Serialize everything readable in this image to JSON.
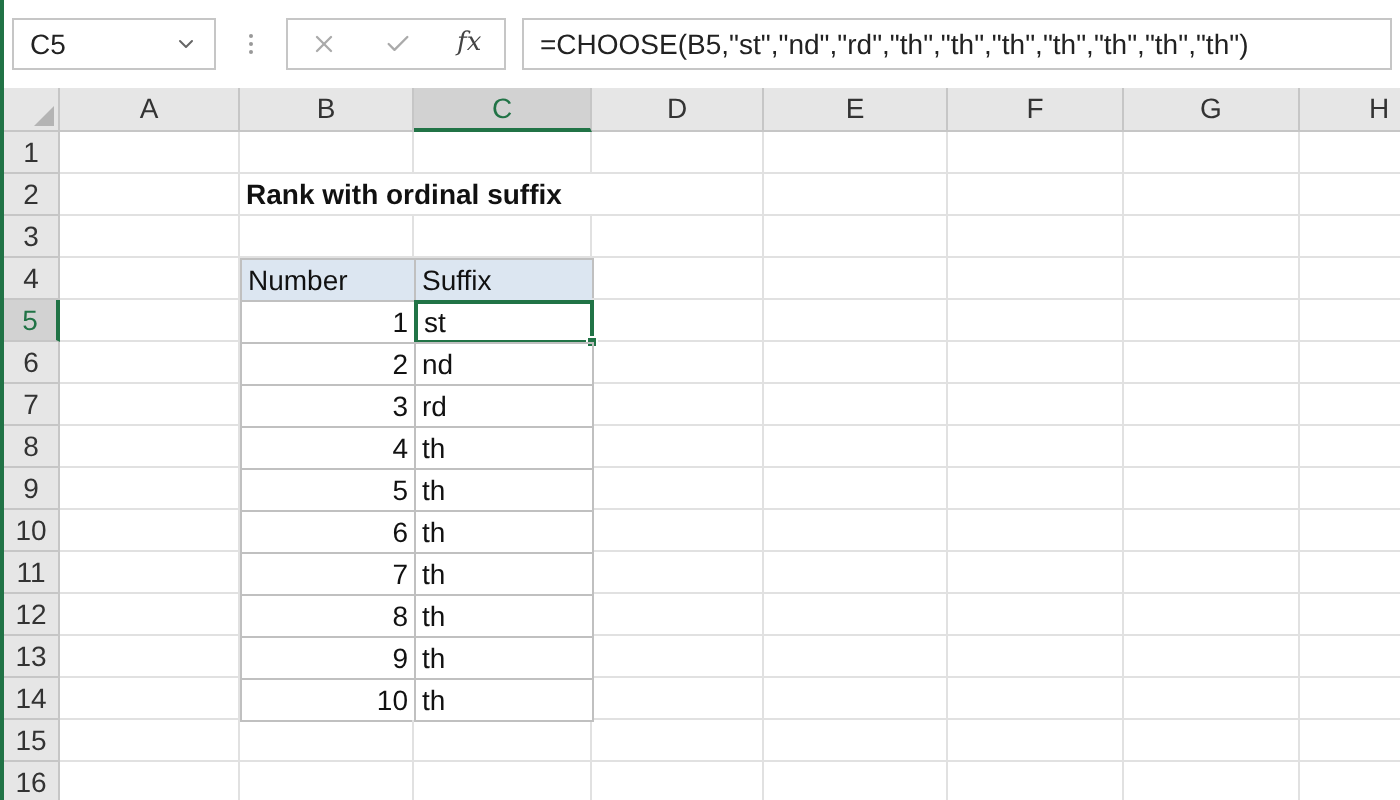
{
  "name_box": "C5",
  "formula_bar": {
    "fx_label": "fx",
    "formula": "=CHOOSE(B5,\"st\",\"nd\",\"rd\",\"th\",\"th\",\"th\",\"th\",\"th\",\"th\",\"th\")"
  },
  "columns": [
    {
      "label": "A",
      "selected": false
    },
    {
      "label": "B",
      "selected": false
    },
    {
      "label": "C",
      "selected": true
    },
    {
      "label": "D",
      "selected": false
    },
    {
      "label": "E",
      "selected": false
    },
    {
      "label": "F",
      "selected": false
    },
    {
      "label": "G",
      "selected": false
    },
    {
      "label": "H",
      "selected": false
    }
  ],
  "row_headers": [
    {
      "label": "1",
      "selected": false
    },
    {
      "label": "2",
      "selected": false
    },
    {
      "label": "3",
      "selected": false
    },
    {
      "label": "4",
      "selected": false
    },
    {
      "label": "5",
      "selected": true
    },
    {
      "label": "6",
      "selected": false
    },
    {
      "label": "7",
      "selected": false
    },
    {
      "label": "8",
      "selected": false
    },
    {
      "label": "9",
      "selected": false
    },
    {
      "label": "10",
      "selected": false
    },
    {
      "label": "11",
      "selected": false
    },
    {
      "label": "12",
      "selected": false
    },
    {
      "label": "13",
      "selected": false
    },
    {
      "label": "14",
      "selected": false
    },
    {
      "label": "15",
      "selected": false
    },
    {
      "label": "16",
      "selected": false
    }
  ],
  "title": "Rank with ordinal suffix",
  "table": {
    "columns": [
      "Number",
      "Suffix"
    ],
    "rows": [
      {
        "number": "1",
        "suffix": "st",
        "selected": true
      },
      {
        "number": "2",
        "suffix": "nd",
        "selected": false
      },
      {
        "number": "3",
        "suffix": "rd",
        "selected": false
      },
      {
        "number": "4",
        "suffix": "th",
        "selected": false
      },
      {
        "number": "5",
        "suffix": "th",
        "selected": false
      },
      {
        "number": "6",
        "suffix": "th",
        "selected": false
      },
      {
        "number": "7",
        "suffix": "th",
        "selected": false
      },
      {
        "number": "8",
        "suffix": "th",
        "selected": false
      },
      {
        "number": "9",
        "suffix": "th",
        "selected": false
      },
      {
        "number": "10",
        "suffix": "th",
        "selected": false
      }
    ]
  }
}
